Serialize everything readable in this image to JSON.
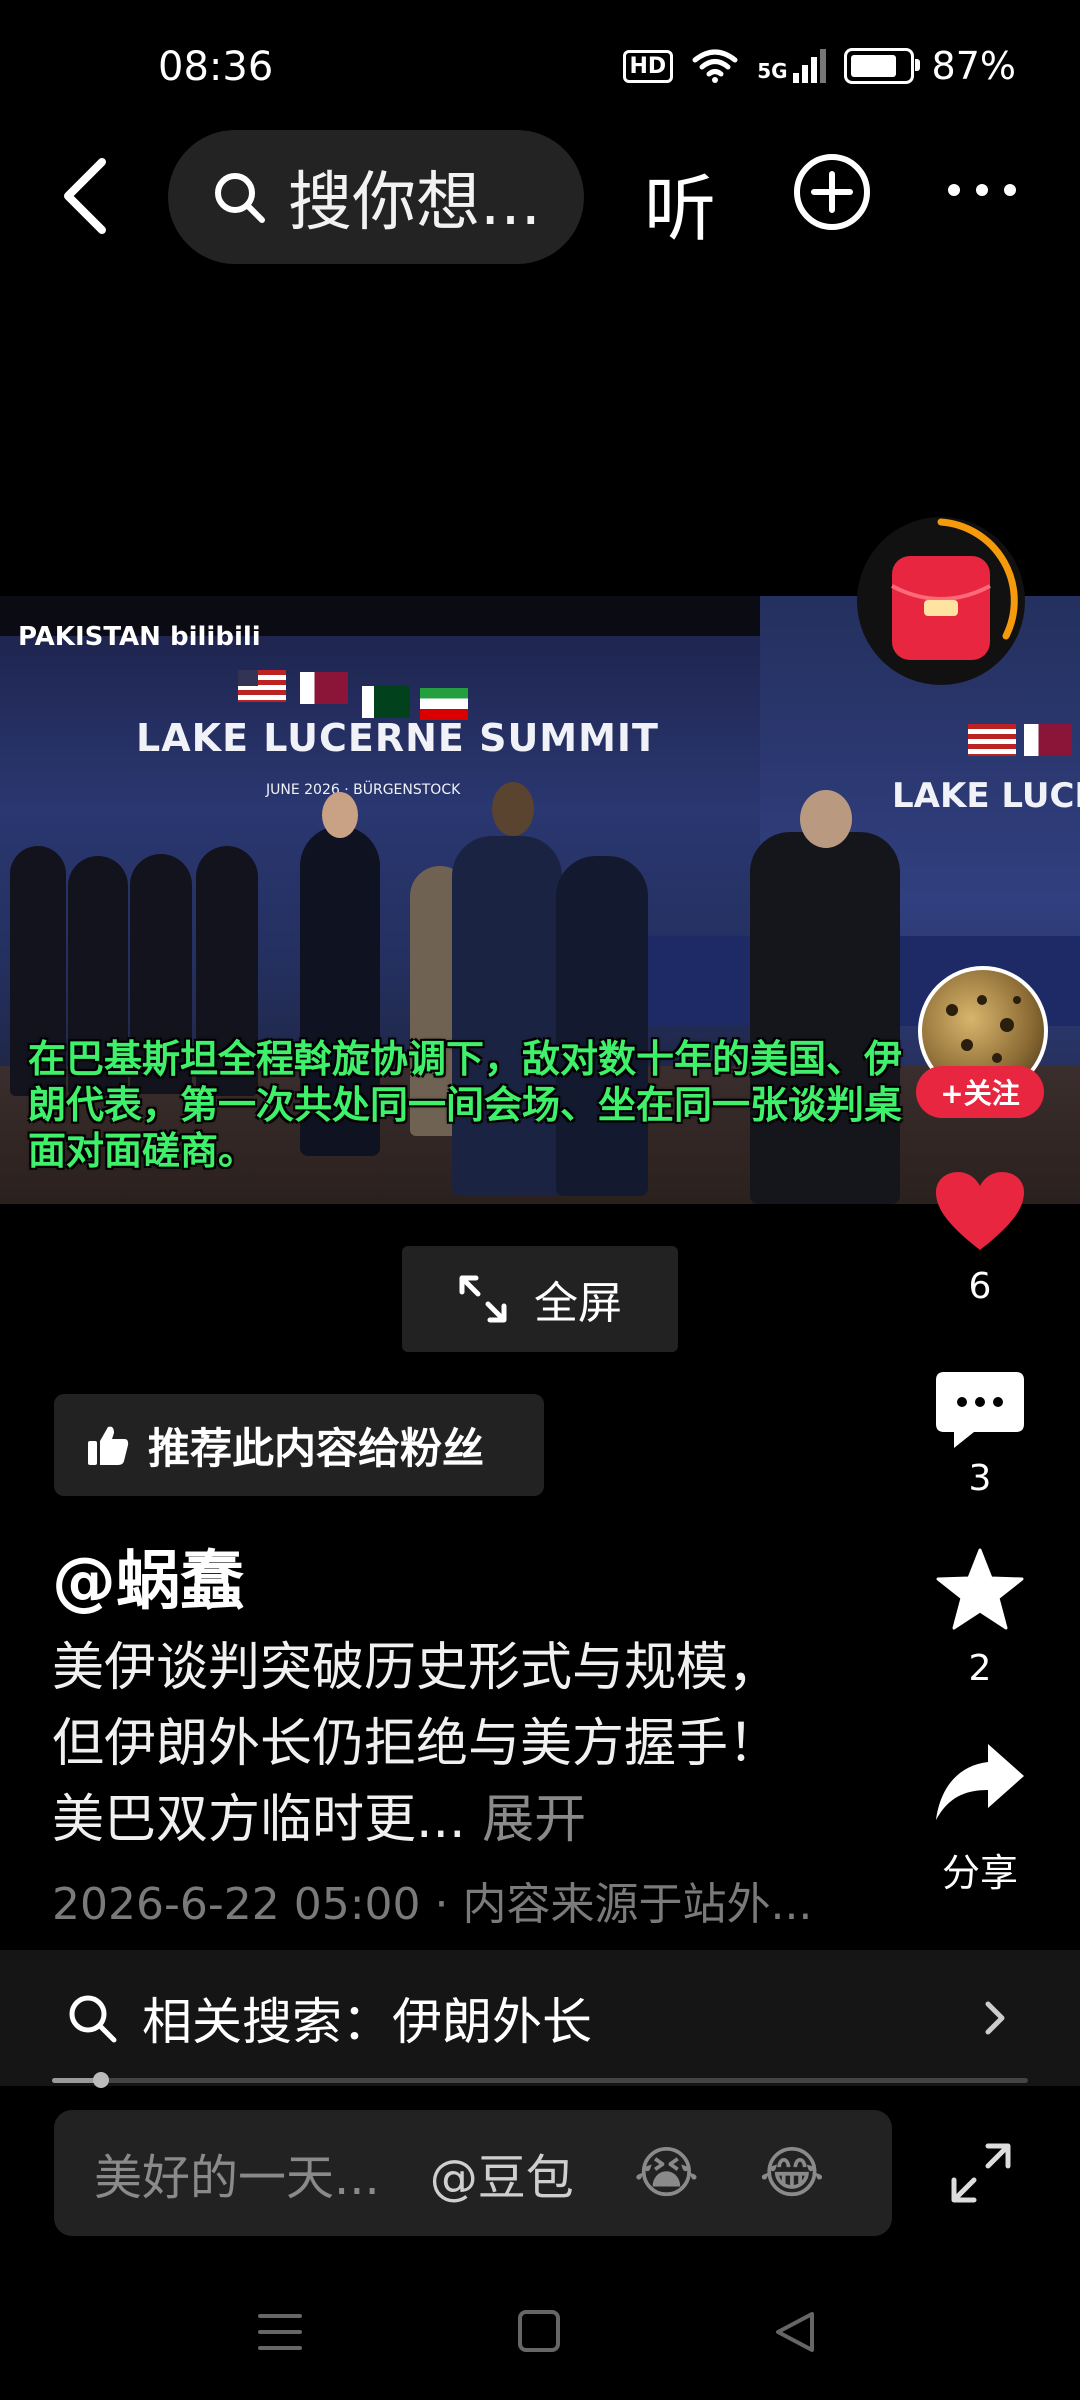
{
  "status_bar": {
    "time": "08:36",
    "hd": "HD",
    "network": "5G",
    "battery": "87%",
    "battery_level": 0.87
  },
  "top_nav": {
    "search_placeholder": "搜你想...",
    "listen_label": "听"
  },
  "video": {
    "watermark": "PAKISTAN bilibili",
    "summit_title": "LAKE LUCERNE SUMMIT",
    "summit_title_right": "LAKE LUCER",
    "summit_date": "JUNE 2026 · BÜRGENSTOCK",
    "subtitle": "在巴基斯坦全程斡旋协调下，敌对数十年的美国、伊朗代表，第一次共处同一间会场、坐在同一张谈判桌面对面磋商。"
  },
  "fullscreen_label": "全屏",
  "right_rail": {
    "follow_label": "+关注",
    "likes": "6",
    "comments": "3",
    "favorites": "2",
    "share_label": "分享"
  },
  "post": {
    "recommend_label": "推荐此内容给粉丝",
    "author": "@蜗蠢",
    "description": "美伊谈判突破历史形式与规模，但伊朗外长仍拒绝与美方握手！美巴双方临时更...",
    "expand_label": "展开",
    "meta": "2026-6-22 05:00 · 内容来源于站外..."
  },
  "related_search": {
    "label": "相关搜索：伊朗外长"
  },
  "progress": 0.05,
  "comment_bar": {
    "placeholder": "美好的一天...",
    "mention": "@豆包",
    "emoji1": "😭",
    "emoji2": "😂"
  },
  "colors": {
    "accent_red": "#e8263f",
    "subtitle_green": "#3ff06b",
    "progress_ring": "#f59a0c"
  }
}
